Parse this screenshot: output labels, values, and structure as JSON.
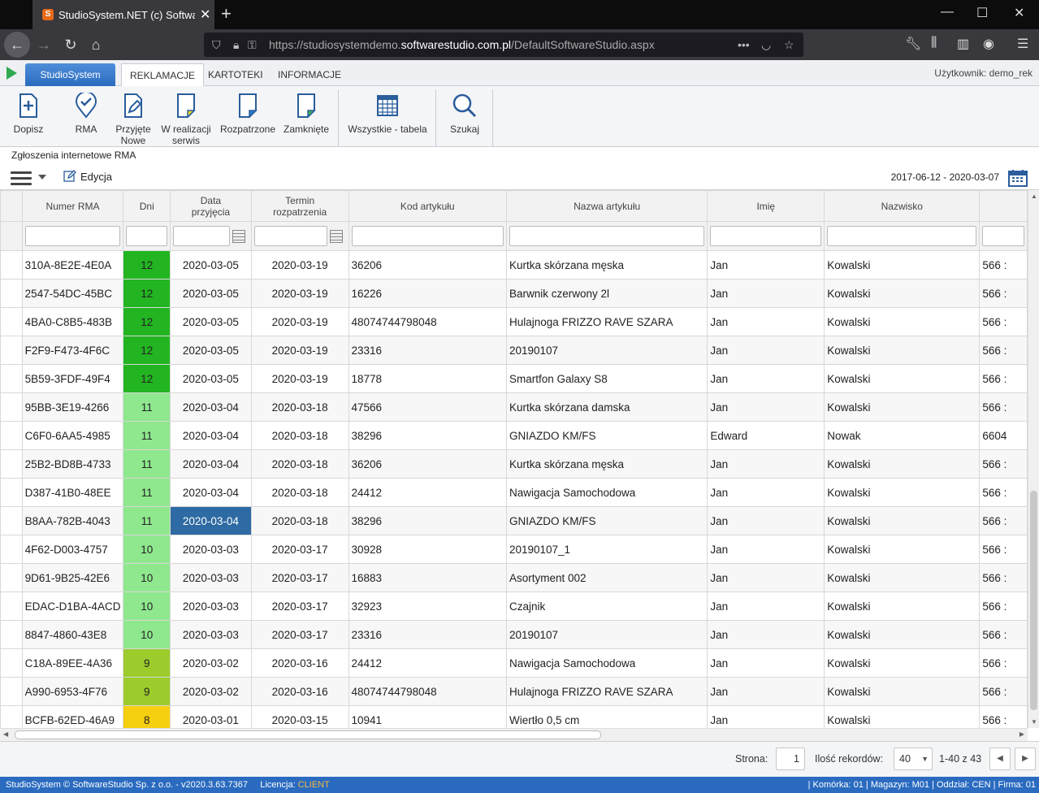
{
  "browser": {
    "tab_title": "StudioSystem.NET (c) Software",
    "url_prefix": "https://studiosystemdemo.",
    "url_domain": "softwarestudio.com.pl",
    "url_suffix": "/DefaultSoftwareStudio.aspx",
    "url_more": "•••"
  },
  "app": {
    "tabs": [
      "StudioSystem",
      "REKLAMACJE",
      "KARTOTEKI",
      "INFORMACJE"
    ],
    "user_label": "Użytkownik: demo_rek"
  },
  "ribbon": {
    "buttons": [
      {
        "label1": "Dopisz",
        "label2": ""
      },
      {
        "label1": "RMA",
        "label2": ""
      },
      {
        "label1": "Przyjęte",
        "label2": "Nowe"
      },
      {
        "label1": "W realizacji",
        "label2": "serwis"
      },
      {
        "label1": "Rozpatrzone",
        "label2": ""
      },
      {
        "label1": "Zamknięte",
        "label2": ""
      },
      {
        "label1": "Wszystkie - tabela",
        "label2": ""
      },
      {
        "label1": "Szukaj",
        "label2": ""
      }
    ]
  },
  "section_title": "Zgłoszenia internetowe RMA",
  "toolbar": {
    "edit_label": "Edycja",
    "date_range": "2017-06-12 - 2020-03-07"
  },
  "grid": {
    "headers": {
      "rma": "Numer RMA",
      "dni": "Dni",
      "data1": "Data",
      "data2": "przyjęcia",
      "termin1": "Termin",
      "termin2": "rozpatrzenia",
      "kod": "Kod artykułu",
      "nazwa": "Nazwa artykułu",
      "imie": "Imię",
      "nazwisko": "Nazwisko"
    },
    "rows": [
      {
        "rma": "310A-8E2E-4E0A",
        "dni": "12",
        "data": "2020-03-05",
        "termin": "2020-03-19",
        "kod": "36206",
        "nazwa": "Kurtka skórzana męska",
        "imie": "Jan",
        "nazwisko": "Kowalski",
        "extra": "566 :",
        "dni_color": "#22b521"
      },
      {
        "rma": "2547-54DC-45BC",
        "dni": "12",
        "data": "2020-03-05",
        "termin": "2020-03-19",
        "kod": "16226",
        "nazwa": "Barwnik czerwony 2l",
        "imie": "Jan",
        "nazwisko": "Kowalski",
        "extra": "566 :",
        "dni_color": "#22b521"
      },
      {
        "rma": "4BA0-C8B5-483B",
        "dni": "12",
        "data": "2020-03-05",
        "termin": "2020-03-19",
        "kod": "48074744798048",
        "nazwa": "Hulajnoga FRIZZO RAVE SZARA",
        "imie": "Jan",
        "nazwisko": "Kowalski",
        "extra": "566 :",
        "dni_color": "#22b521"
      },
      {
        "rma": "F2F9-F473-4F6C",
        "dni": "12",
        "data": "2020-03-05",
        "termin": "2020-03-19",
        "kod": "23316",
        "nazwa": "20190107",
        "imie": "Jan",
        "nazwisko": "Kowalski",
        "extra": "566 :",
        "dni_color": "#22b521"
      },
      {
        "rma": "5B59-3FDF-49F4",
        "dni": "12",
        "data": "2020-03-05",
        "termin": "2020-03-19",
        "kod": "18778",
        "nazwa": "Smartfon Galaxy S8",
        "imie": "Jan",
        "nazwisko": "Kowalski",
        "extra": "566 :",
        "dni_color": "#22b521"
      },
      {
        "rma": "95BB-3E19-4266",
        "dni": "11",
        "data": "2020-03-04",
        "termin": "2020-03-18",
        "kod": "47566",
        "nazwa": "Kurtka skórzana damska",
        "imie": "Jan",
        "nazwisko": "Kowalski",
        "extra": "566 :",
        "dni_color": "#8fe88e"
      },
      {
        "rma": "C6F0-6AA5-4985",
        "dni": "11",
        "data": "2020-03-04",
        "termin": "2020-03-18",
        "kod": "38296",
        "nazwa": "GNIAZDO KM/FS",
        "imie": "Edward",
        "nazwisko": "Nowak",
        "extra": "6604",
        "dni_color": "#8fe88e"
      },
      {
        "rma": "25B2-BD8B-4733",
        "dni": "11",
        "data": "2020-03-04",
        "termin": "2020-03-18",
        "kod": "36206",
        "nazwa": "Kurtka skórzana męska",
        "imie": "Jan",
        "nazwisko": "Kowalski",
        "extra": "566 :",
        "dni_color": "#8fe88e"
      },
      {
        "rma": "D387-41B0-48EE",
        "dni": "11",
        "data": "2020-03-04",
        "termin": "2020-03-18",
        "kod": "24412",
        "nazwa": "Nawigacja Samochodowa",
        "imie": "Jan",
        "nazwisko": "Kowalski",
        "extra": "566 :",
        "dni_color": "#8fe88e"
      },
      {
        "rma": "B8AA-782B-4043",
        "dni": "11",
        "data": "2020-03-04",
        "termin": "2020-03-18",
        "kod": "38296",
        "nazwa": "GNIAZDO KM/FS",
        "imie": "Jan",
        "nazwisko": "Kowalski",
        "extra": "566 :",
        "dni_color": "#8fe88e",
        "highlight": true
      },
      {
        "rma": "4F62-D003-4757",
        "dni": "10",
        "data": "2020-03-03",
        "termin": "2020-03-17",
        "kod": "30928",
        "nazwa": "20190107_1",
        "imie": "Jan",
        "nazwisko": "Kowalski",
        "extra": "566 :",
        "dni_color": "#8fe88e"
      },
      {
        "rma": "9D61-9B25-42E6",
        "dni": "10",
        "data": "2020-03-03",
        "termin": "2020-03-17",
        "kod": "16883",
        "nazwa": "Asortyment 002",
        "imie": "Jan",
        "nazwisko": "Kowalski",
        "extra": "566 :",
        "dni_color": "#8fe88e"
      },
      {
        "rma": "EDAC-D1BA-4ACD",
        "dni": "10",
        "data": "2020-03-03",
        "termin": "2020-03-17",
        "kod": "32923",
        "nazwa": "Czajnik",
        "imie": "Jan",
        "nazwisko": "Kowalski",
        "extra": "566 :",
        "dni_color": "#8fe88e"
      },
      {
        "rma": "8847-4860-43E8",
        "dni": "10",
        "data": "2020-03-03",
        "termin": "2020-03-17",
        "kod": "23316",
        "nazwa": "20190107",
        "imie": "Jan",
        "nazwisko": "Kowalski",
        "extra": "566 :",
        "dni_color": "#8fe88e"
      },
      {
        "rma": "C18A-89EE-4A36",
        "dni": "9",
        "data": "2020-03-02",
        "termin": "2020-03-16",
        "kod": "24412",
        "nazwa": "Nawigacja Samochodowa",
        "imie": "Jan",
        "nazwisko": "Kowalski",
        "extra": "566 :",
        "dni_color": "#9ccc2b"
      },
      {
        "rma": "A990-6953-4F76",
        "dni": "9",
        "data": "2020-03-02",
        "termin": "2020-03-16",
        "kod": "48074744798048",
        "nazwa": "Hulajnoga FRIZZO RAVE SZARA",
        "imie": "Jan",
        "nazwisko": "Kowalski",
        "extra": "566 :",
        "dni_color": "#9ccc2b"
      },
      {
        "rma": "BCFB-62ED-46A9",
        "dni": "8",
        "data": "2020-03-01",
        "termin": "2020-03-15",
        "kod": "10941",
        "nazwa": "Wiertło 0,5 cm",
        "imie": "Jan",
        "nazwisko": "Kowalski",
        "extra": "566 :",
        "dni_color": "#f6cf10"
      }
    ]
  },
  "pager": {
    "page_label": "Strona:",
    "page_value": "1",
    "records_label": "Ilość rekordów:",
    "records_value": "40",
    "range": "1-40 z 43"
  },
  "status": {
    "copyright": "StudioSystem © SoftwareStudio Sp. z o.o. - v2020.3.63.7367",
    "license_label": "Licencja:",
    "license_value": "CLIENT",
    "right": "| Komórka: 01 | Magazyn: M01 | Oddział: CEN | Firma: 01"
  }
}
